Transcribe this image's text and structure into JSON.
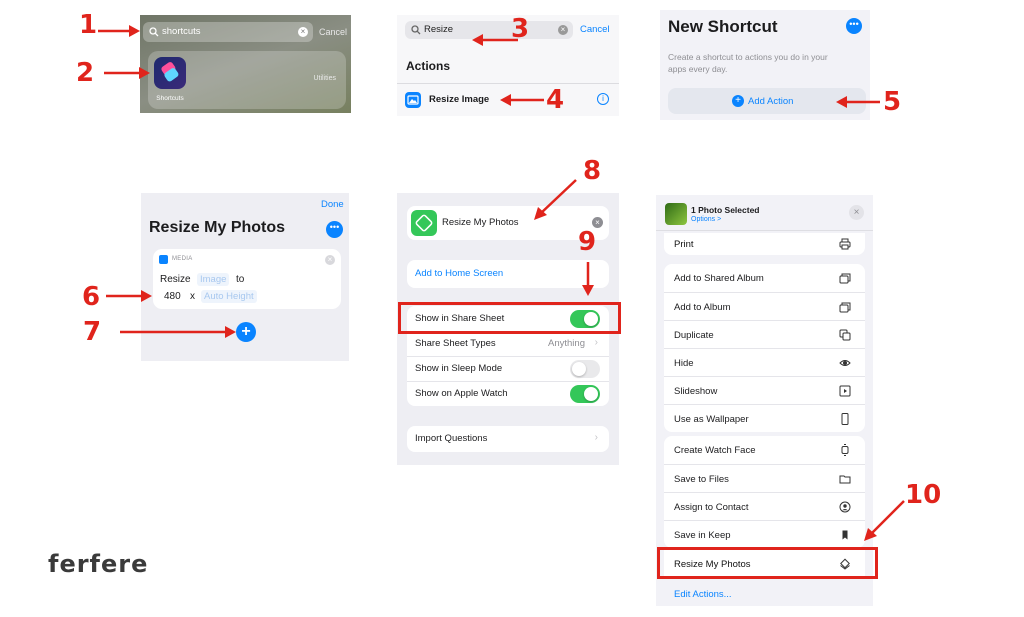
{
  "steps": [
    "1",
    "2",
    "3",
    "4",
    "5",
    "6",
    "7",
    "8",
    "9",
    "10"
  ],
  "spotlight": {
    "search_value": "shortcuts",
    "cancel": "Cancel",
    "app_name": "Shortcuts",
    "app_category": "Utilities"
  },
  "actions_search": {
    "search_value": "Resize",
    "cancel": "Cancel",
    "section_title": "Actions",
    "result_label": "Resize Image"
  },
  "new_shortcut": {
    "title": "New Shortcut",
    "description_line1": "Create a shortcut to actions you do in your",
    "description_line2": "apps every day.",
    "add_action": "Add Action"
  },
  "editor": {
    "done": "Done",
    "title": "Resize My Photos",
    "card_category": "MEDIA",
    "verb": "Resize",
    "param_image": "Image",
    "to": "to",
    "width": "480",
    "x": "x",
    "height_placeholder": "Auto Height"
  },
  "details": {
    "shortcut_name": "Resize My Photos",
    "add_home": "Add to Home Screen",
    "show_share": "Show in Share Sheet",
    "share_types": "Share Sheet Types",
    "share_types_value": "Anything",
    "show_sleep": "Show in Sleep Mode",
    "show_watch": "Show on Apple Watch",
    "import_questions": "Import Questions"
  },
  "share_sheet": {
    "title": "1 Photo Selected",
    "options": "Options >",
    "top_item": "Print",
    "group1": [
      "Add to Shared Album",
      "Add to Album",
      "Duplicate",
      "Hide",
      "Slideshow",
      "Use as Wallpaper"
    ],
    "group2": [
      "Create Watch Face",
      "Save to Files",
      "Assign to Contact",
      "Save in Keep"
    ],
    "highlighted": "Resize My Photos",
    "edit_actions": "Edit Actions..."
  },
  "brand": {
    "logo": "FerFere"
  },
  "colors": {
    "accent": "#e0241c",
    "ios_blue": "#0a84ff",
    "ios_green": "#34c759"
  }
}
